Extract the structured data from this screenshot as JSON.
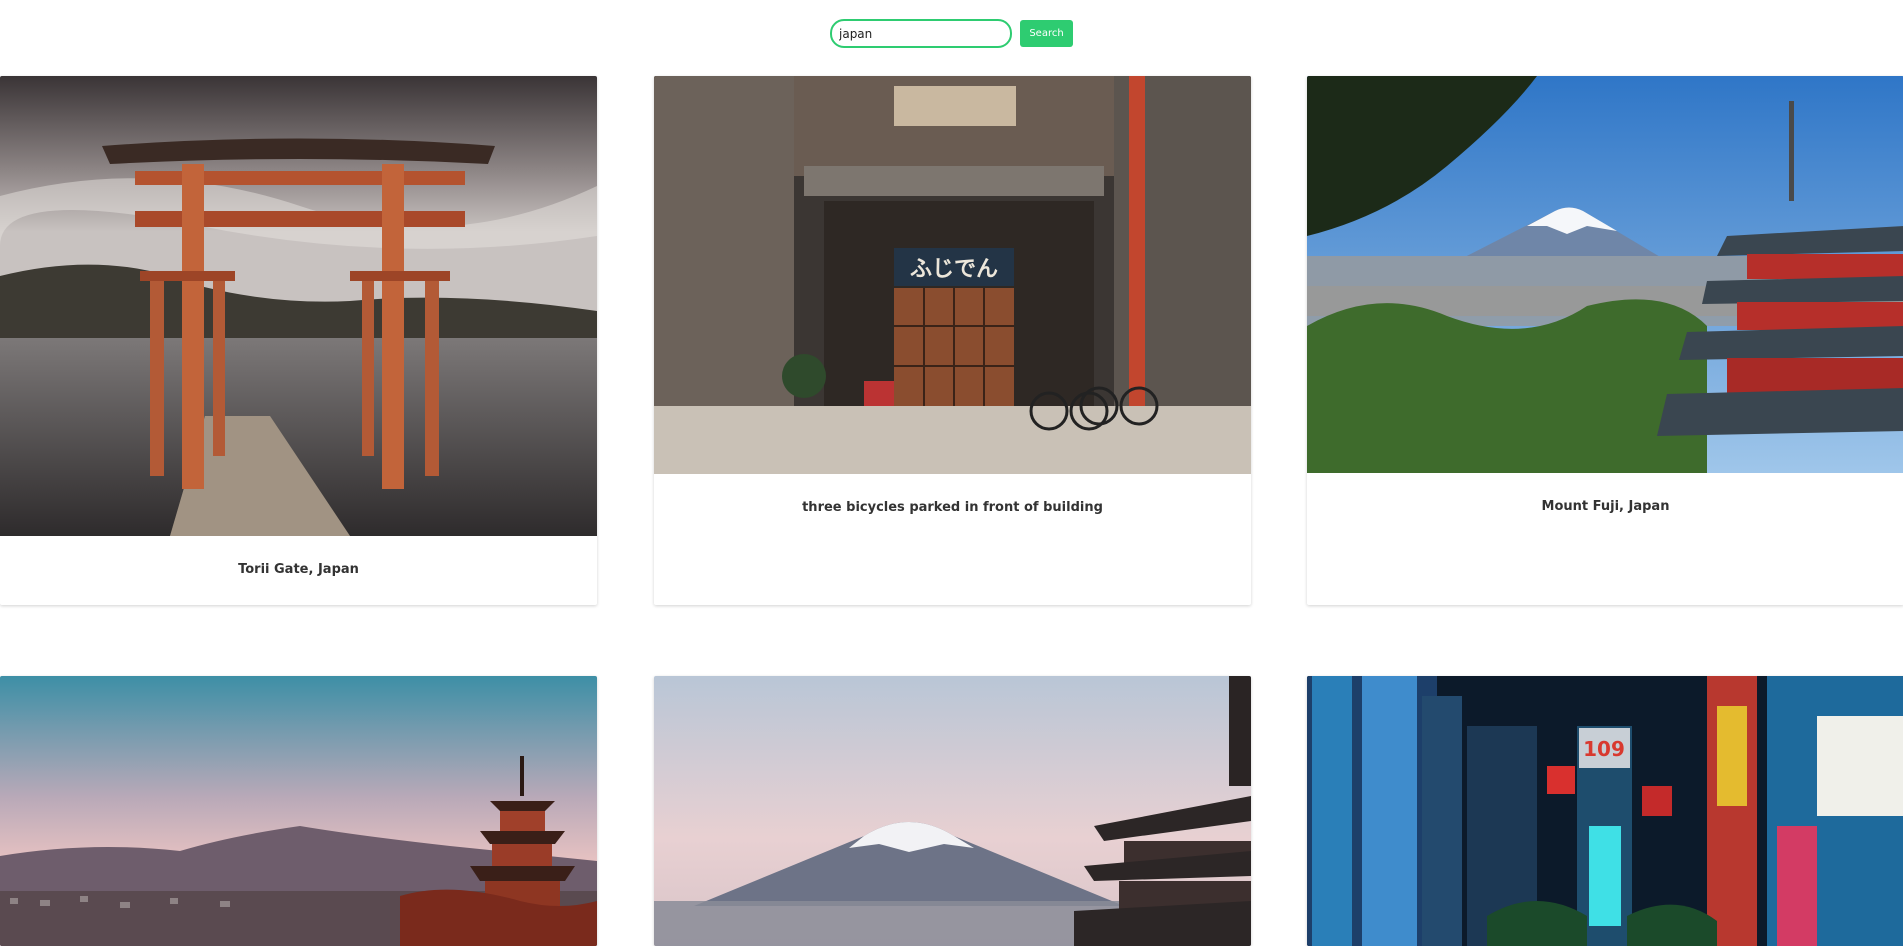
{
  "search": {
    "placeholder": "",
    "value": "japan",
    "button_label": "Search"
  },
  "accent_color": "#2ecc71",
  "cards": [
    {
      "title": "Torii Gate, Japan",
      "image": "torii-gate-lake-photo"
    },
    {
      "title": "three bicycles parked in front of building",
      "image": "shop-front-bicycles-photo",
      "sign_text": "ふじでん"
    },
    {
      "title": "Mount Fuji, Japan",
      "image": "mount-fuji-pagoda-photo"
    },
    {
      "title": "",
      "image": "kyoto-pagoda-sunset-photo"
    },
    {
      "title": "",
      "image": "fuji-pagoda-dusk-photo"
    },
    {
      "title": "",
      "image": "shibuya-night-photo",
      "sign_text": "109"
    }
  ]
}
